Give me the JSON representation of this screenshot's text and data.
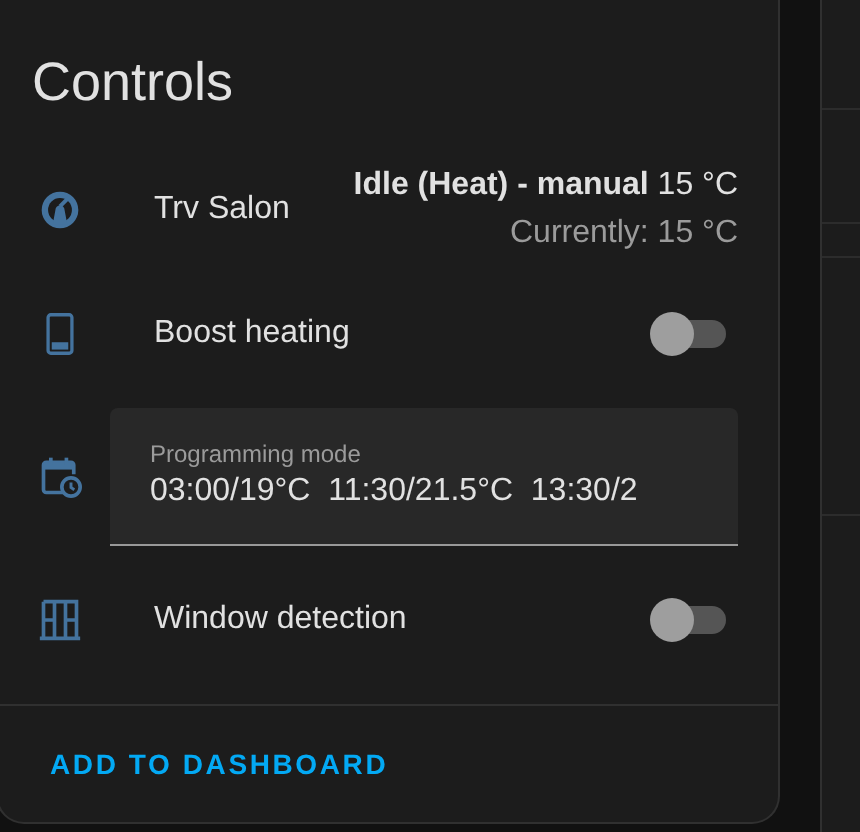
{
  "card": {
    "title": "Controls",
    "rows": [
      {
        "kind": "state",
        "label": "Trv Salon",
        "state": "**Idle (Heat) - manual** 15 °C",
        "current": "Currently: 15 °C"
      },
      {
        "kind": "toggle",
        "label": "Boost heating",
        "on": false
      },
      {
        "kind": "text_field",
        "placeholder": "Programming mode",
        "value": "03:00/19°C  11:30/21.5°C  13:30/2"
      },
      {
        "kind": "toggle",
        "label": "Window detection",
        "on": false
      }
    ],
    "action": "ADD TO DASHBOARD"
  }
}
